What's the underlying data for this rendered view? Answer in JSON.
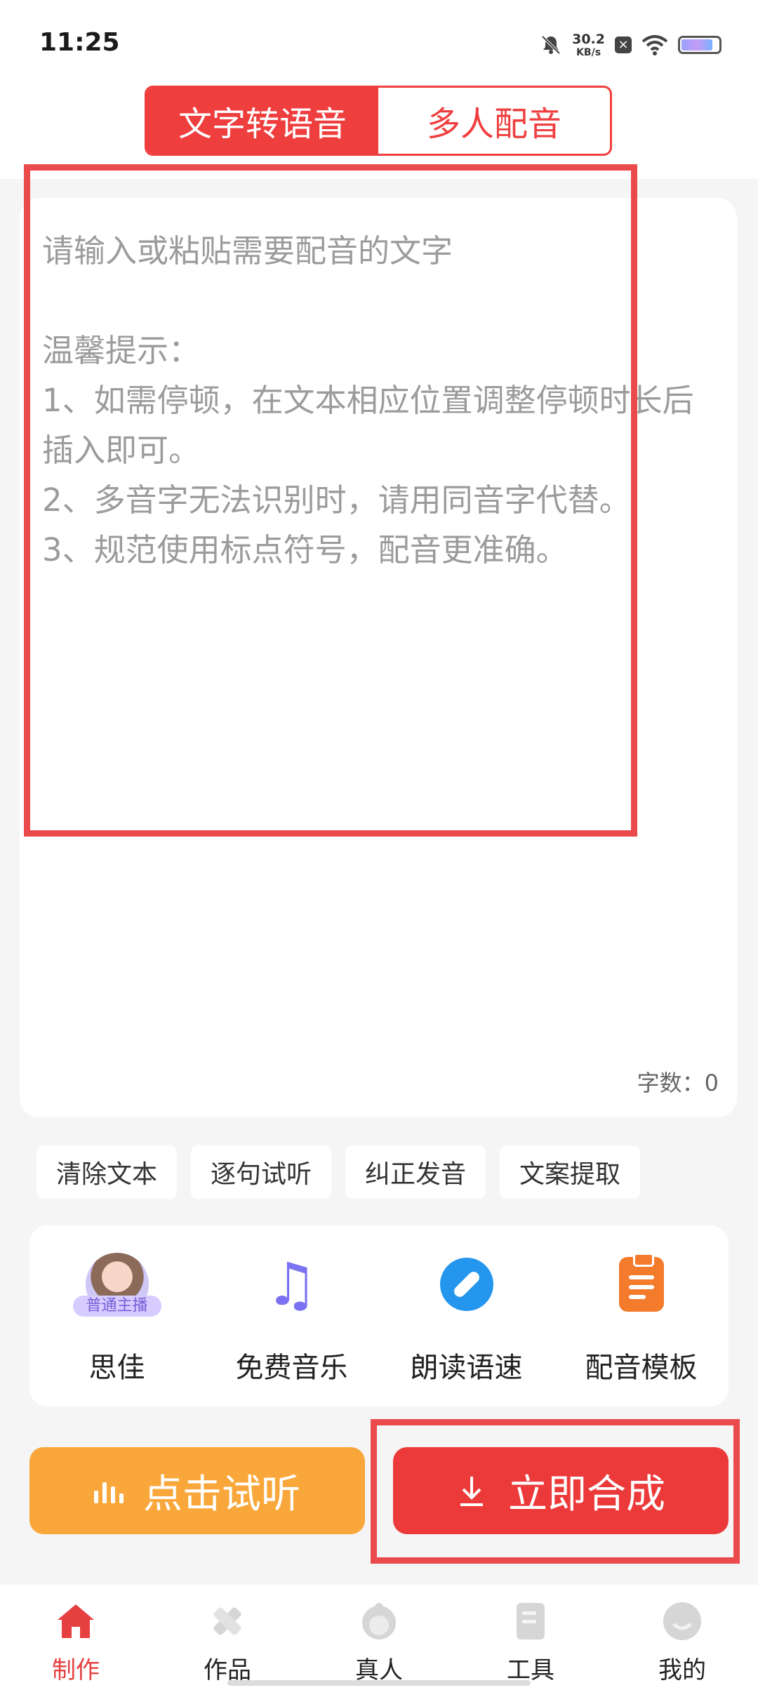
{
  "status_bar": {
    "time": "11:25",
    "network_speed_value": "30.2",
    "network_speed_unit": "KB/s"
  },
  "mode_tabs": [
    {
      "label": "文字转语音",
      "active": true
    },
    {
      "label": "多人配音",
      "active": false
    }
  ],
  "editor": {
    "placeholder": "请输入或粘贴需要配音的文字\n\n温馨提示：\n1、如需停顿，在文本相应位置调整停顿时长后插入即可。\n2、多音字无法识别时，请用同音字代替。\n3、规范使用标点符号，配音更准确。",
    "word_count_label": "字数：0"
  },
  "actions": [
    "清除文本",
    "逐句试听",
    "纠正发音",
    "文案提取"
  ],
  "tools": {
    "voice": {
      "label": "思佳",
      "badge": "普通主播"
    },
    "music": {
      "label": "免费音乐"
    },
    "speed": {
      "label": "朗读语速"
    },
    "template": {
      "label": "配音模板"
    }
  },
  "buttons": {
    "listen": "点击试听",
    "synthesize": "立即合成"
  },
  "bottom_nav": [
    {
      "label": "制作",
      "active": true
    },
    {
      "label": "作品",
      "active": false
    },
    {
      "label": "真人",
      "active": false
    },
    {
      "label": "工具",
      "active": false
    },
    {
      "label": "我的",
      "active": false
    }
  ],
  "colors": {
    "accent_red": "#ef3e3e",
    "listen_orange": "#f9a73a",
    "annotation_box": "#ea4a4c"
  }
}
